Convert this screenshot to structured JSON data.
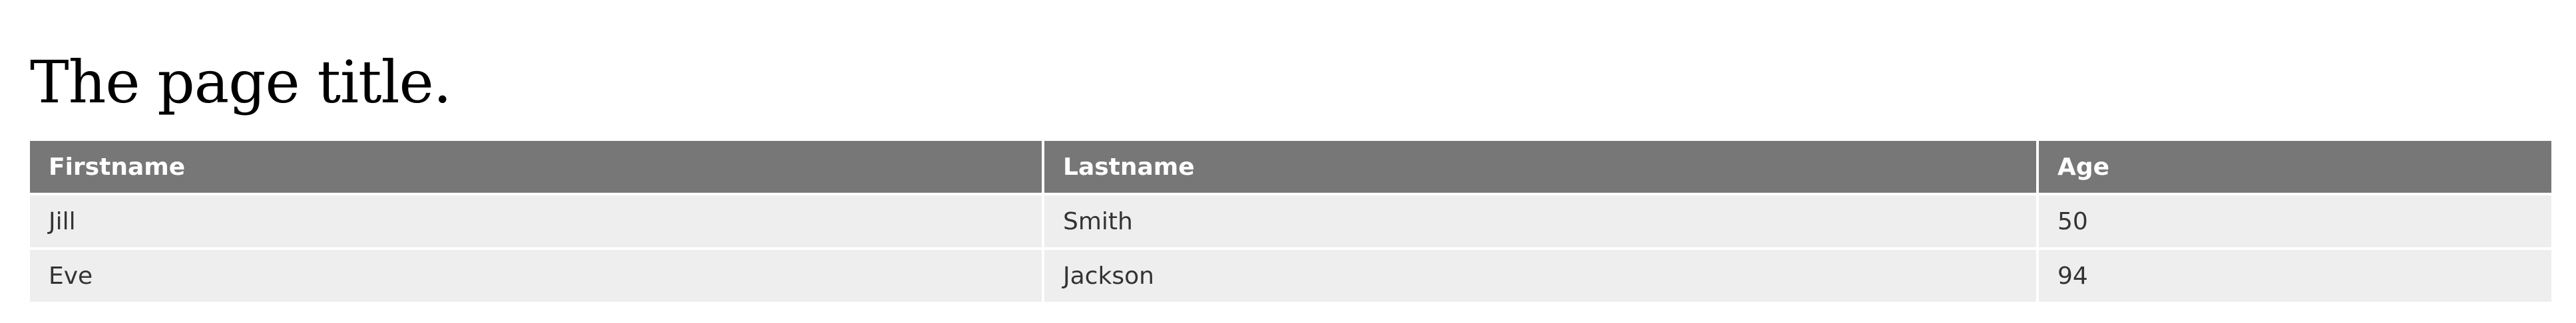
{
  "page": {
    "title": "The page title."
  },
  "table": {
    "headers": [
      "Firstname",
      "Lastname",
      "Age"
    ],
    "rows": [
      [
        "Jill",
        "Smith",
        "50"
      ],
      [
        "Eve",
        "Jackson",
        "94"
      ]
    ]
  },
  "colors": {
    "header_bg": "#777777",
    "header_text": "#ffffff",
    "row_bg": "#eeeeee",
    "row_text": "#333333"
  }
}
